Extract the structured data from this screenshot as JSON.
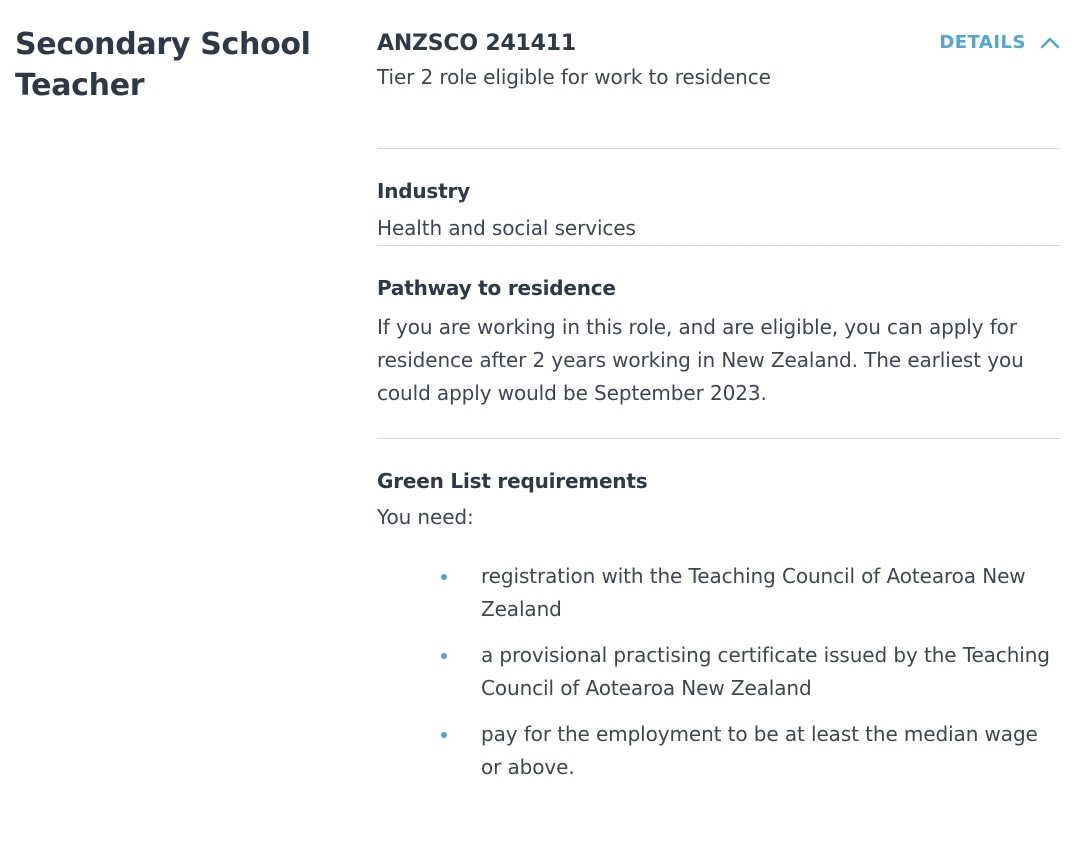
{
  "role": {
    "title": "Secondary School Teacher"
  },
  "summary": {
    "code": "ANZSCO 241411",
    "tier": "Tier 2 role eligible for work to residence",
    "toggle_label": "DETAILS",
    "toggle_icon": "chevron-up-icon"
  },
  "industry": {
    "heading": "Industry",
    "value": "Health and social services"
  },
  "pathway": {
    "heading": "Pathway to residence",
    "text": "If you are working in this role, and are eligible, you can apply for residence after 2 years working in New Zealand. The earliest you could apply would be September 2023."
  },
  "green_list": {
    "heading": "Green List requirements",
    "intro": "You need:",
    "items": [
      "registration with the Teaching Council of Aotearoa New Zealand",
      "a provisional practising certificate issued by the Teaching Council of Aotearoa New Zealand",
      "pay for the employment to be at least the median wage or above."
    ]
  },
  "colors": {
    "accent": "#4ea6d4",
    "heading": "#2f3847",
    "text": "#3f4653",
    "divider": "#d6d8dc"
  }
}
